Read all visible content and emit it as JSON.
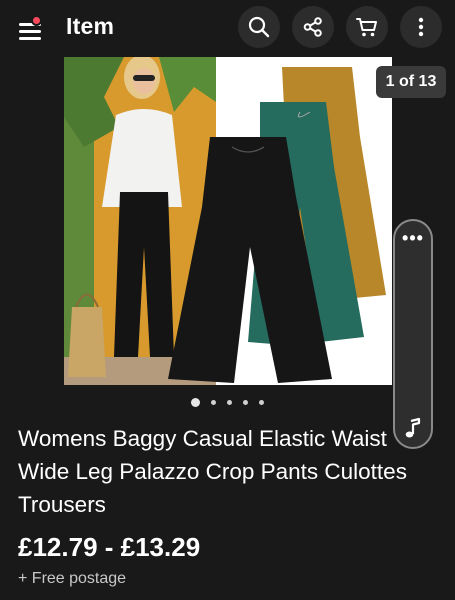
{
  "header": {
    "title": "Item"
  },
  "gallery": {
    "counter": "1 of 13",
    "image_count": 5,
    "active_index": 0,
    "product_colors": [
      "#1a1a1a",
      "#256b5e",
      "#b8872a"
    ]
  },
  "product": {
    "title": "Womens Baggy Casual Elastic Waist Wide Leg Palazzo Crop Pants Culottes Trousers",
    "price": "£12.79 - £13.29",
    "shipping": "+ Free postage"
  },
  "side_panel": {
    "more": "•••"
  },
  "colors": {
    "background": "#191919",
    "notification": "#ff4a5e"
  }
}
